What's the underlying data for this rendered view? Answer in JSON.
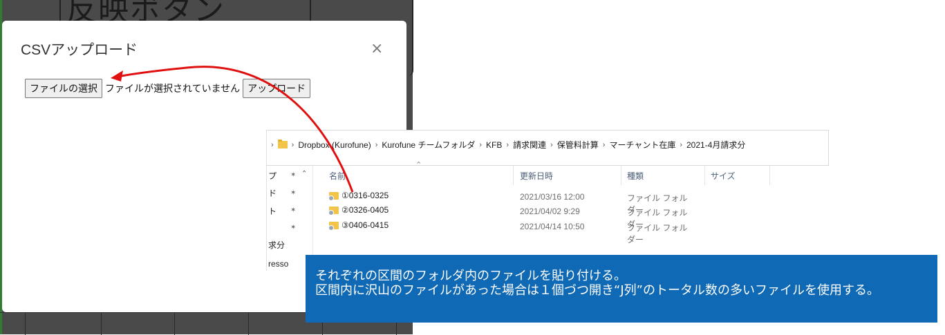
{
  "background": {
    "partial_title": "反映ボタン"
  },
  "modal": {
    "title": "CSVアップロード",
    "close_glyph": "×",
    "choose_file_label": "ファイルの選択",
    "no_file_text": "ファイルが選択されていません",
    "upload_label": "アップロード"
  },
  "explorer": {
    "breadcrumb": [
      "Dropbox (Kurofune)",
      "Kurofune チームフォルダ",
      "KFB",
      "請求関連",
      "保管料計算",
      "マーチャント在庫",
      "2021-4月請求分"
    ],
    "columns": {
      "name": "名前",
      "date": "更新日時",
      "type": "種類",
      "size": "サイズ"
    },
    "nav_items": [
      "プ",
      "ド",
      "ト",
      "",
      "求分",
      "resso"
    ],
    "rows": [
      {
        "name": "①0316-0325",
        "date": "2021/03/16 12:00",
        "type": "ファイル フォルダー"
      },
      {
        "name": "②0326-0405",
        "date": "2021/04/02 9:29",
        "type": "ファイル フォルダー"
      },
      {
        "name": "③0406-0415",
        "date": "2021/04/14 10:50",
        "type": "ファイル フォルダー"
      }
    ]
  },
  "callout": {
    "line1": "それぞれの区間のフォルダ内のファイルを貼り付ける。",
    "line2": "区間内に沢山のファイルがあった場合は１個づつ開き“J列”のトータル数の多いファイルを使用する。"
  },
  "colors": {
    "callout_bg": "#0f69b4",
    "arrow": "#e01010",
    "folder": "#f3c44a"
  }
}
